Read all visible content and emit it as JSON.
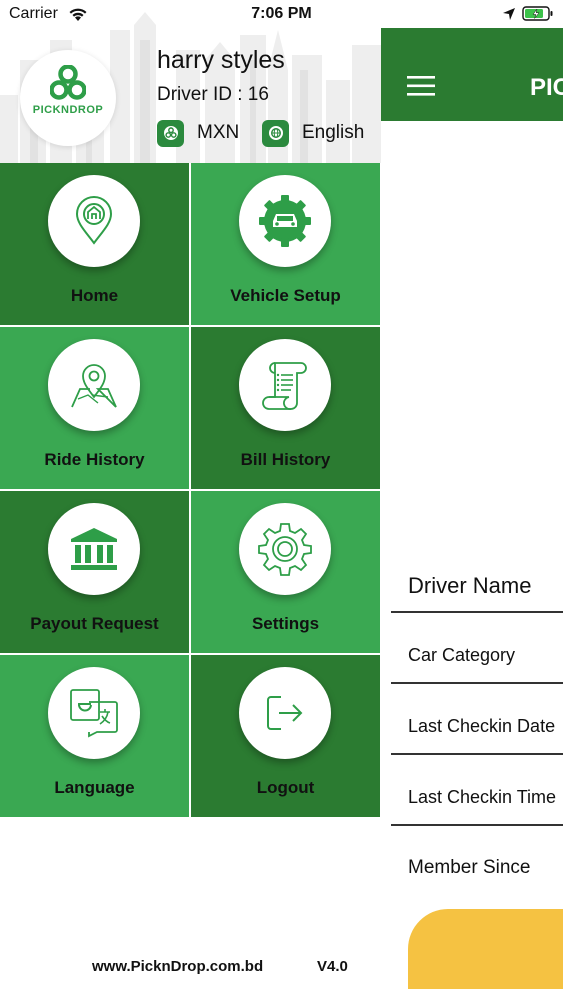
{
  "status_bar": {
    "carrier": "Carrier",
    "time": "7:06 PM"
  },
  "drawer": {
    "logo_text": "PICKNDROP",
    "driver_name": "harry styles",
    "driver_id": "Driver ID : 16",
    "currency": "MXN",
    "language": "English",
    "menu": [
      {
        "label": "Home",
        "icon": "home-pin-icon"
      },
      {
        "label": "Vehicle Setup",
        "icon": "car-gear-icon"
      },
      {
        "label": "Ride History",
        "icon": "map-pin-icon"
      },
      {
        "label": "Bill History",
        "icon": "receipt-scroll-icon"
      },
      {
        "label": "Payout Request",
        "icon": "bank-icon"
      },
      {
        "label": "Settings",
        "icon": "gear-icon"
      },
      {
        "label": "Language",
        "icon": "translate-icon"
      },
      {
        "label": "Logout",
        "icon": "logout-icon"
      }
    ],
    "footer_url": "www.PicknDrop.com.bd",
    "footer_version": "V4.0"
  },
  "content": {
    "title": "PIC",
    "rows": [
      "Driver Name",
      "Car Category",
      "Last Checkin Date",
      "Last Checkin Time",
      "Member Since"
    ]
  },
  "colors": {
    "dark_green": "#2b7b31",
    "light_green": "#3aa852",
    "icon_green": "#2e9e48",
    "accent_yellow": "#f5c242"
  }
}
